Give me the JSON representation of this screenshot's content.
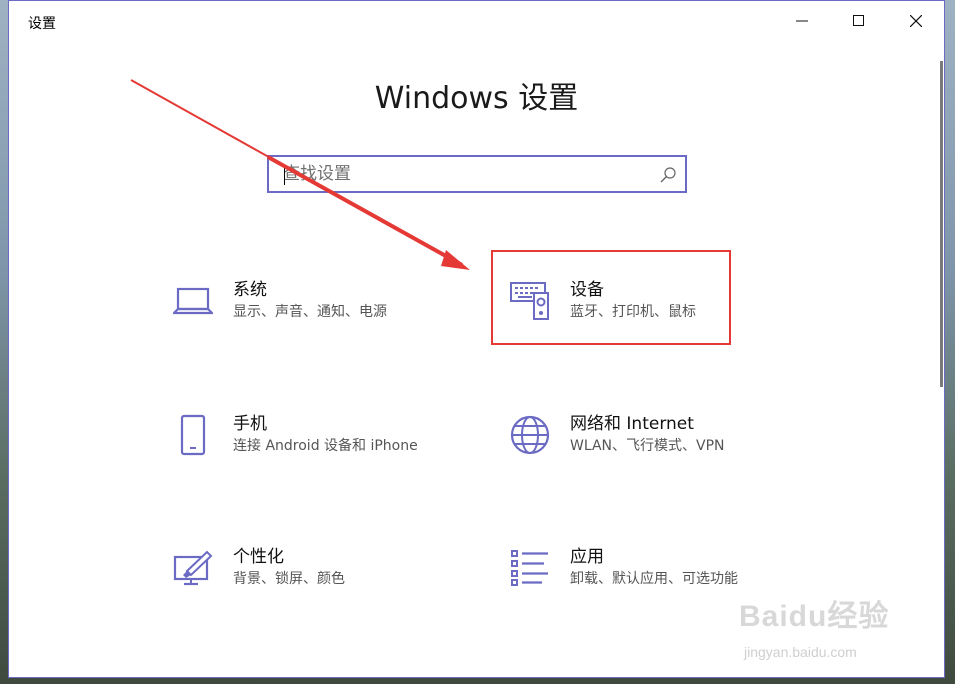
{
  "window": {
    "title": "设置"
  },
  "controls": {
    "minimize": "minimize-icon",
    "maximize": "maximize-icon",
    "close": "close-icon"
  },
  "heading": "Windows 设置",
  "search": {
    "placeholder": "查找设置",
    "icon": "search-icon"
  },
  "categories": [
    {
      "label": "系统",
      "desc": "显示、声音、通知、电源",
      "icon": "laptop-icon"
    },
    {
      "label": "设备",
      "desc": "蓝牙、打印机、鼠标",
      "icon": "keyboard-speaker-icon"
    },
    {
      "label": "手机",
      "desc": "连接 Android 设备和 iPhone",
      "icon": "phone-icon"
    },
    {
      "label": "网络和 Internet",
      "desc": "WLAN、飞行模式、VPN",
      "icon": "globe-icon"
    },
    {
      "label": "个性化",
      "desc": "背景、锁屏、颜色",
      "icon": "paint-screen-icon"
    },
    {
      "label": "应用",
      "desc": "卸载、默认应用、可选功能",
      "icon": "app-list-icon"
    }
  ],
  "watermark": {
    "brand": "Baidu经验",
    "url": "jingyan.baidu.com"
  },
  "colors": {
    "accent": "#6b6bc4",
    "highlight": "#e53935"
  }
}
